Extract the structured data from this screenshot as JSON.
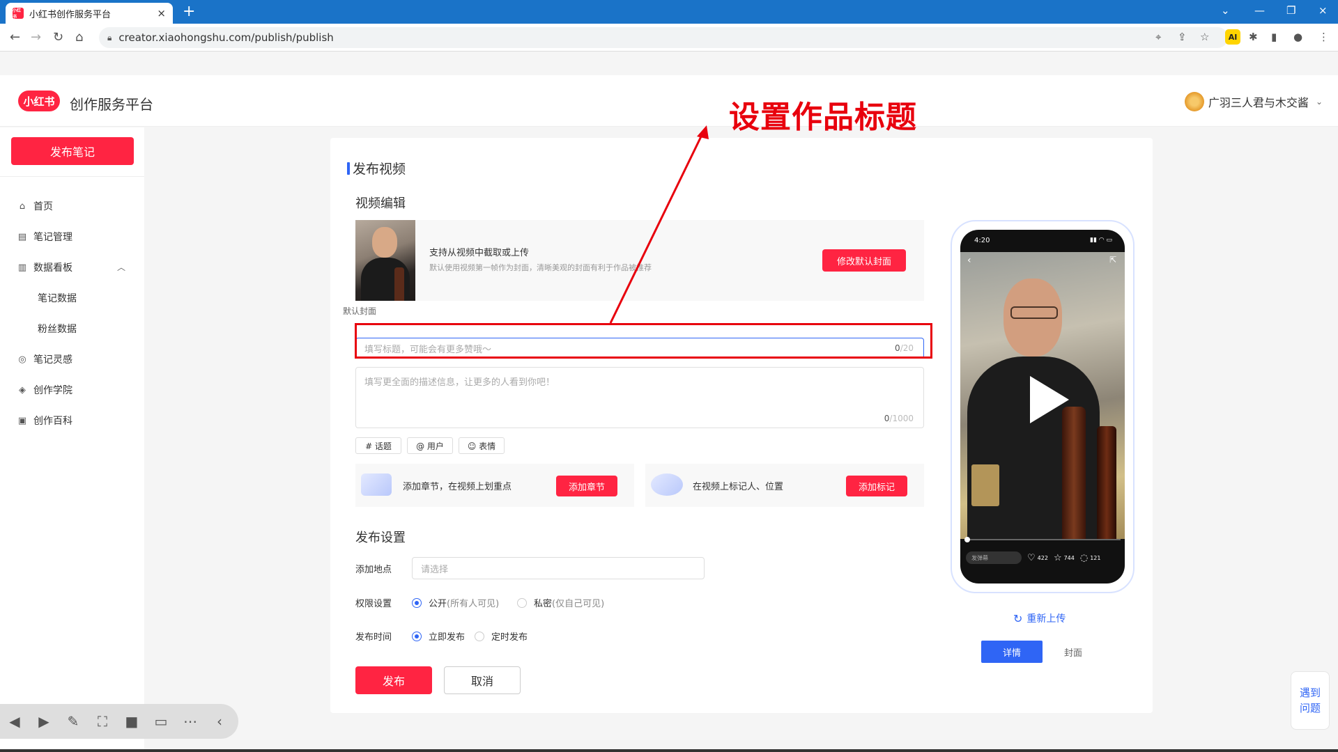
{
  "browser": {
    "tab_title": "小红书创作服务平台",
    "favicon_text": "小红书",
    "close_glyph": "×",
    "newtab_glyph": "+",
    "url": "creator.xiaohongshu.com/publish/publish",
    "ext_label": "AI"
  },
  "header": {
    "logo_text": "小红书",
    "title": "创作服务平台",
    "user_name": "广羽三人君与木交酱"
  },
  "sidebar": {
    "publish_button": "发布笔记",
    "items": [
      {
        "label": "首页",
        "icon": "home-icon"
      },
      {
        "label": "笔记管理",
        "icon": "notes-icon"
      },
      {
        "label": "数据看板",
        "icon": "chart-icon"
      },
      {
        "label": "笔记灵感",
        "icon": "inspiration-icon"
      },
      {
        "label": "创作学院",
        "icon": "academy-icon"
      },
      {
        "label": "创作百科",
        "icon": "wiki-icon"
      }
    ],
    "sub_items": [
      "笔记数据",
      "粉丝数据"
    ]
  },
  "main": {
    "page_title": "发布视频",
    "video_edit_title": "视频编辑",
    "cover": {
      "caption": "默认封面",
      "main_text": "支持从视频中截取或上传",
      "sub_text": "默认使用视频第一帧作为封面，清晰美观的封面有利于作品被推荐",
      "button": "修改默认封面"
    },
    "title_input": {
      "placeholder": "填写标题，可能会有更多赞哦～",
      "count": "0",
      "max": "/20"
    },
    "desc_input": {
      "placeholder": "填写更全面的描述信息，让更多的人看到你吧！",
      "count": "0",
      "max": "/1000"
    },
    "tags": {
      "topic": "# 话题",
      "user": "@ 用户",
      "emoji": "☺ 表情"
    },
    "chapters": {
      "text": "添加章节，在视频上划重点",
      "button": "添加章节"
    },
    "marks": {
      "text": "在视频上标记人、位置",
      "button": "添加标记"
    },
    "publish_settings": {
      "title": "发布设置",
      "location_label": "添加地点",
      "location_placeholder": "请选择",
      "permission_label": "权限设置",
      "public_label": "公开",
      "public_hint": "(所有人可见)",
      "private_label": "私密",
      "private_hint": "(仅自己可见)",
      "time_label": "发布时间",
      "now_label": "立即发布",
      "scheduled_label": "定时发布"
    },
    "publish_button": "发布",
    "cancel_button": "取消"
  },
  "preview": {
    "status_time": "4:20",
    "danmu_placeholder": "发弹幕",
    "likes": "422",
    "stars": "744",
    "comments": "121",
    "reupload": "重新上传",
    "tab_detail": "详情",
    "tab_cover": "封面"
  },
  "annotation": {
    "text": "设置作品标题",
    "color": "#e8000d"
  },
  "help": {
    "line1": "遇到",
    "line2": "问题"
  },
  "colors": {
    "brand_red": "#ff2442",
    "accent_blue": "#2f65f5"
  }
}
